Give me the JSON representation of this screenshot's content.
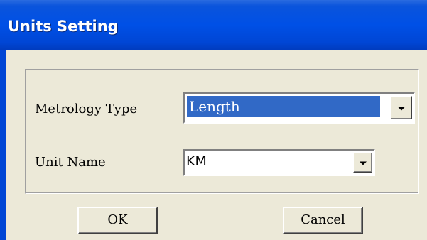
{
  "window": {
    "title": "Units Setting"
  },
  "form": {
    "metrology_type": {
      "label": "Metrology Type",
      "value": "Length"
    },
    "unit_name": {
      "label": "Unit Name",
      "value": "KM"
    }
  },
  "buttons": {
    "ok_label": "OK",
    "cancel_label": "Cancel"
  },
  "icons": {
    "dropdown": "chevron-down-icon"
  },
  "colors": {
    "titlebar": "#0050e6",
    "selection": "#3169c6",
    "dialog_bg": "#ece9d8"
  }
}
